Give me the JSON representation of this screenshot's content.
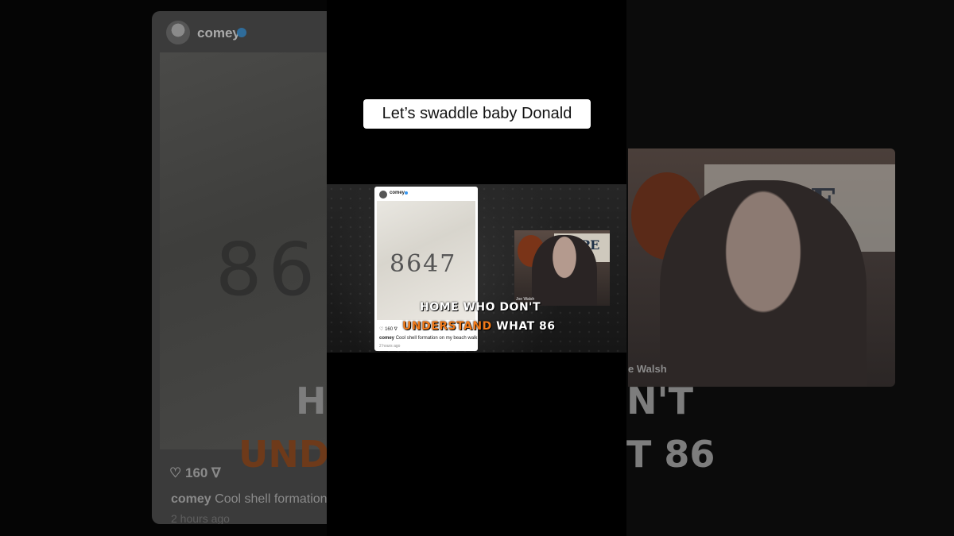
{
  "overlay": {
    "title": "Let’s swaddle baby Donald"
  },
  "post": {
    "username": "comey",
    "likes": "160",
    "caption_user": "comey",
    "caption_text": "Cool shell formation on my beach walk",
    "time": "2 hours ago",
    "shell_text": "8647"
  },
  "background_left": {
    "username": "comey",
    "likes": "160",
    "caption_user": "comey",
    "caption_text": "Cool shell formation",
    "time": "2 hours ago",
    "shell_text": "86",
    "big_caption_1": "H",
    "big_caption_2": "UND"
  },
  "background_right": {
    "sign_text": "HOPE",
    "name_fragment": "e Walsh",
    "big_caption_1": "N'T",
    "big_caption_2": "T 86"
  },
  "webcam": {
    "name": "Joe Walsh",
    "sign_text": "HOPE"
  },
  "captions": {
    "line1": "HOME WHO DON'T",
    "line2_highlight": "UNDERSTAND",
    "line2_rest": " WHAT 86"
  },
  "colors": {
    "caption_highlight": "#f07a1a",
    "verified": "#3897f0"
  }
}
